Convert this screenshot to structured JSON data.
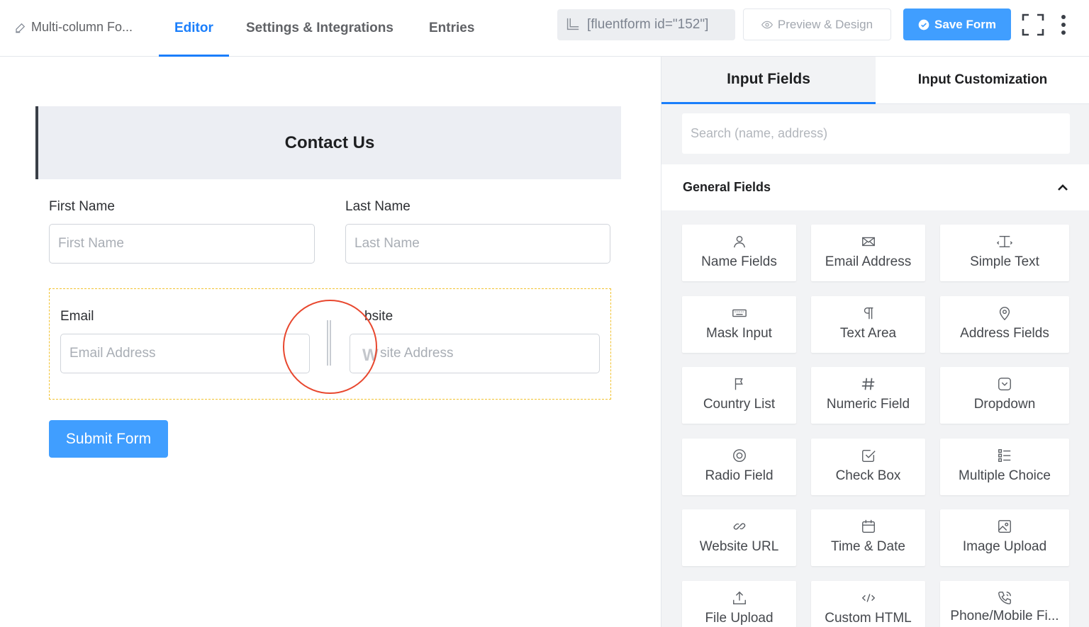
{
  "topbar": {
    "form_name": "Multi-column Fo...",
    "tabs": [
      {
        "label": "Editor",
        "active": true
      },
      {
        "label": "Settings & Integrations",
        "active": false
      },
      {
        "label": "Entries",
        "active": false
      }
    ],
    "shortcode": "[fluentform id=\"152\"]",
    "preview_label": "Preview & Design",
    "save_label": "Save Form"
  },
  "form": {
    "title": "Contact Us",
    "first_name": {
      "label": "First Name",
      "placeholder": "First Name"
    },
    "last_name": {
      "label": "Last Name",
      "placeholder": "Last Name"
    },
    "email": {
      "label": "Email",
      "placeholder": "Email Address"
    },
    "website": {
      "label": "bsite",
      "placeholder": "site Address",
      "ghost_letter": "W"
    },
    "submit_label": "Submit Form"
  },
  "panel": {
    "tabs": [
      {
        "label": "Input Fields",
        "active": true
      },
      {
        "label": "Input Customization",
        "active": false
      }
    ],
    "search_placeholder": "Search (name, address)",
    "section_title": "General Fields",
    "fields": [
      {
        "label": "Name Fields",
        "icon": "user-icon"
      },
      {
        "label": "Email Address",
        "icon": "envelope-icon"
      },
      {
        "label": "Simple Text",
        "icon": "text-cursor-icon"
      },
      {
        "label": "Mask Input",
        "icon": "keyboard-icon"
      },
      {
        "label": "Text Area",
        "icon": "paragraph-icon"
      },
      {
        "label": "Address Fields",
        "icon": "map-pin-icon"
      },
      {
        "label": "Country List",
        "icon": "flag-icon"
      },
      {
        "label": "Numeric Field",
        "icon": "hash-icon"
      },
      {
        "label": "Dropdown",
        "icon": "dropdown-icon"
      },
      {
        "label": "Radio Field",
        "icon": "radio-icon"
      },
      {
        "label": "Check Box",
        "icon": "checkbox-icon"
      },
      {
        "label": "Multiple Choice",
        "icon": "list-icon"
      },
      {
        "label": "Website URL",
        "icon": "link-icon"
      },
      {
        "label": "Time & Date",
        "icon": "calendar-icon"
      },
      {
        "label": "Image Upload",
        "icon": "image-icon"
      },
      {
        "label": "File Upload",
        "icon": "upload-icon"
      },
      {
        "label": "Custom HTML",
        "icon": "code-icon"
      },
      {
        "label": "Phone/Mobile Fi...",
        "icon": "phone-icon"
      }
    ]
  },
  "colors": {
    "accent": "#1a7efb",
    "button": "#409eff",
    "highlight_circle": "#e8472e",
    "container_border": "#f2c230"
  }
}
